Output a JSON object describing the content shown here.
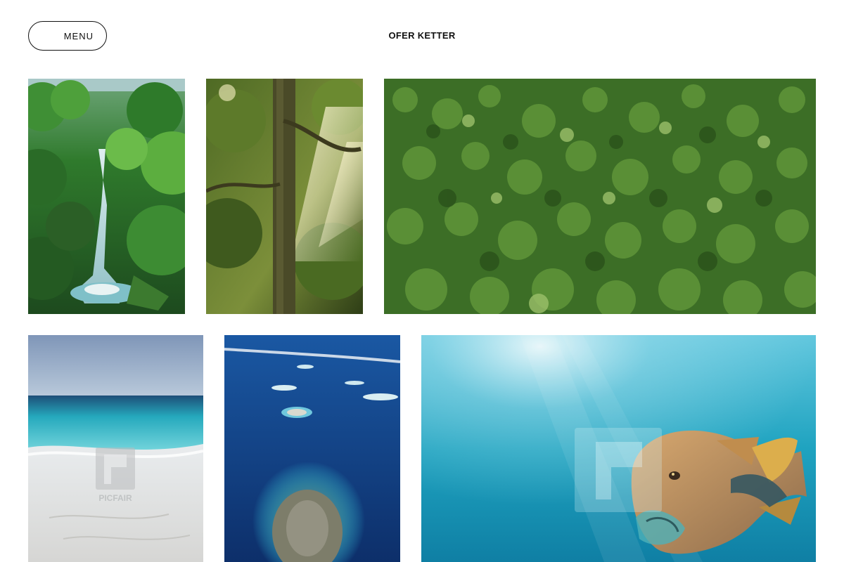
{
  "header": {
    "menu_label": "MENU",
    "site_title": "OFER KETTER"
  },
  "gallery": {
    "images": [
      {
        "name": "rainforest-waterfall"
      },
      {
        "name": "jungle-tree-sunbeams"
      },
      {
        "name": "aerial-rainforest-canopy"
      },
      {
        "name": "white-sand-beach",
        "watermark": "PICFAIR"
      },
      {
        "name": "aerial-atolls-ocean"
      },
      {
        "name": "napoleon-wrasse-underwater"
      }
    ]
  },
  "colors": {
    "text": "#111111",
    "background": "#ffffff"
  }
}
